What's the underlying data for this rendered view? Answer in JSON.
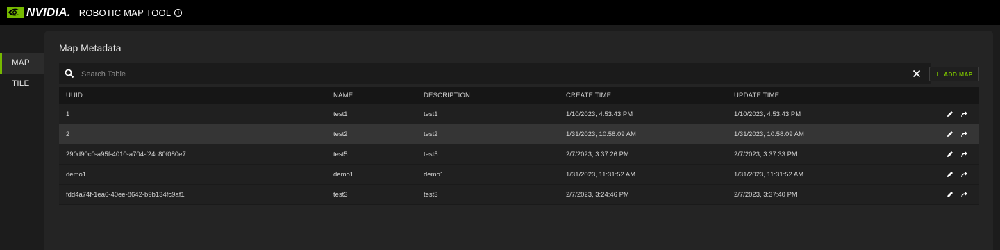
{
  "header": {
    "brand": "NVIDIA.",
    "app_title": "ROBOTIC MAP TOOL",
    "info_icon": "info-icon"
  },
  "nav": {
    "items": [
      {
        "label": "MAP",
        "active": true
      },
      {
        "label": "TILE",
        "active": false
      }
    ]
  },
  "main": {
    "title": "Map Metadata",
    "search": {
      "placeholder": "Search Table",
      "value": ""
    },
    "add_button": {
      "label": "ADD MAP",
      "icon": "plus-icon"
    }
  },
  "table": {
    "columns": [
      "UUID",
      "NAME",
      "DESCRIPTION",
      "CREATE TIME",
      "UPDATE TIME"
    ],
    "rows": [
      {
        "uuid": "1",
        "name": "test1",
        "description": "test1",
        "create_time": "1/10/2023, 4:53:43 PM",
        "update_time": "1/10/2023, 4:53:43 PM"
      },
      {
        "uuid": "2",
        "name": "test2",
        "description": "test2",
        "create_time": "1/31/2023, 10:58:09 AM",
        "update_time": "1/31/2023, 10:58:09 AM"
      },
      {
        "uuid": "290d90c0-a95f-4010-a704-f24c80f080e7",
        "name": "test5",
        "description": "test5",
        "create_time": "2/7/2023, 3:37:26 PM",
        "update_time": "2/7/2023, 3:37:33 PM"
      },
      {
        "uuid": "demo1",
        "name": "demo1",
        "description": "demo1",
        "create_time": "1/31/2023, 11:31:52 AM",
        "update_time": "1/31/2023, 11:31:52 AM"
      },
      {
        "uuid": "fdd4a74f-1ea6-40ee-8642-b9b134fc9af1",
        "name": "test3",
        "description": "test3",
        "create_time": "2/7/2023, 3:24:46 PM",
        "update_time": "2/7/2023, 3:37:40 PM"
      }
    ],
    "highlighted_row": 1,
    "row_actions": [
      "edit-icon",
      "share-icon"
    ]
  },
  "colors": {
    "accent": "#76b900",
    "topbar": "#000000",
    "background": "#1c1c1c",
    "panel": "#242424",
    "row_highlight": "#353535"
  }
}
